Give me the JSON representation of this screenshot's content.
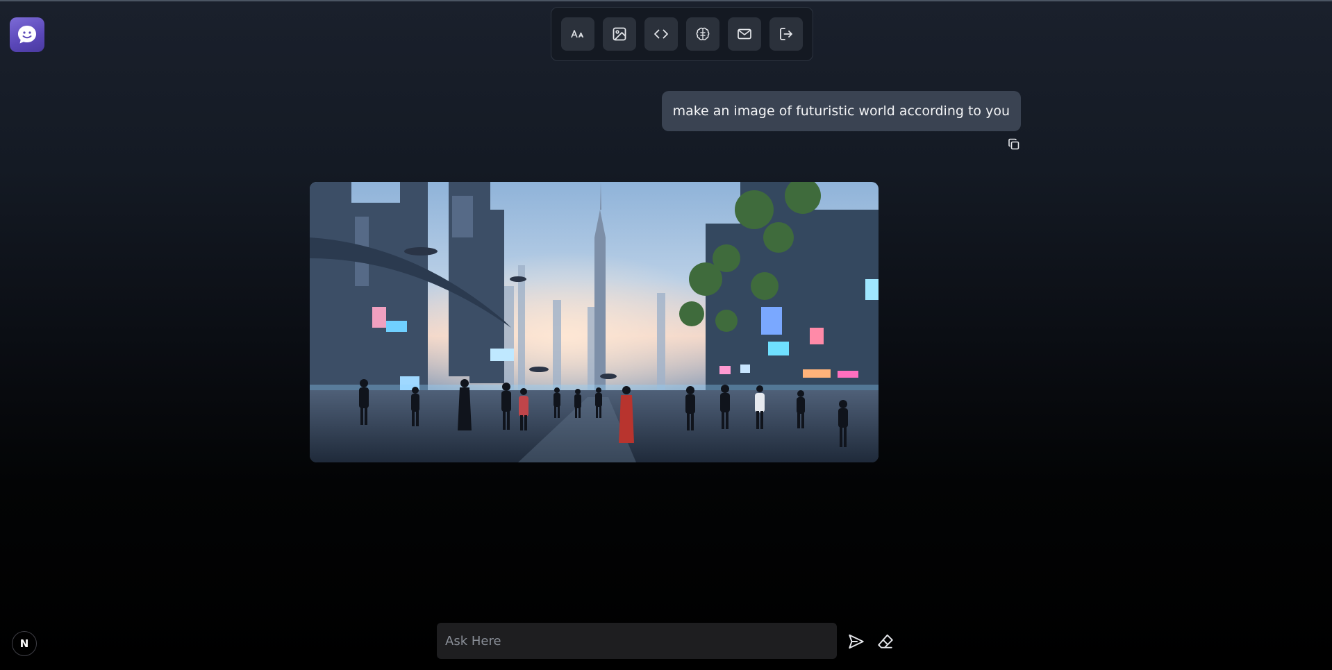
{
  "app": {
    "logo_icon": "chat-bubble-smile-icon"
  },
  "toolbar": {
    "buttons": [
      {
        "icon": "text-format-icon",
        "name": "text-mode-button"
      },
      {
        "icon": "image-icon",
        "name": "image-mode-button"
      },
      {
        "icon": "code-icon",
        "name": "code-mode-button"
      },
      {
        "icon": "brain-icon",
        "name": "brain-mode-button"
      },
      {
        "icon": "mail-icon",
        "name": "mail-button"
      },
      {
        "icon": "logout-icon",
        "name": "logout-button"
      }
    ]
  },
  "chat": {
    "user_message": "make an image of futuristic world according to you",
    "copy_icon": "copy-icon",
    "generated_image_icon": "generated-image"
  },
  "footer": {
    "badge_label": "N",
    "input_placeholder": "Ask Here",
    "input_value": "",
    "send_icon": "send-icon",
    "erase_icon": "eraser-icon"
  },
  "colors": {
    "accent": "#6a58c8",
    "bubble": "#3a4352",
    "toolbar_button": "#2b313b",
    "input_bg": "#1e1e20"
  }
}
